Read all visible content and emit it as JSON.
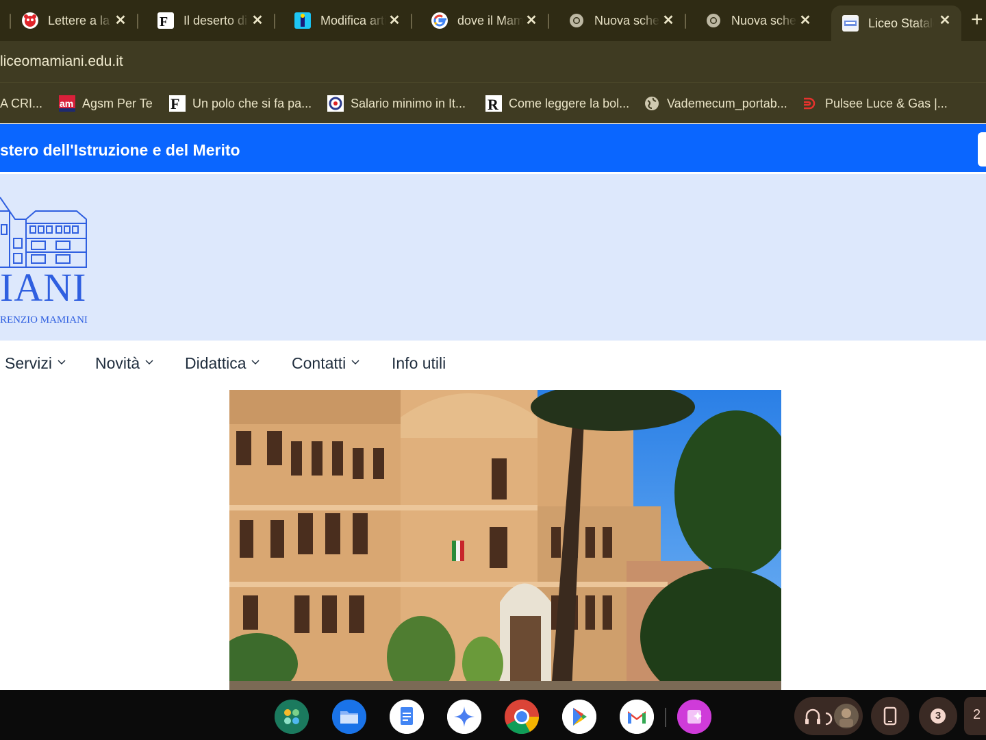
{
  "browser": {
    "tabs": [
      {
        "title": "Lettere a la redazione",
        "active": false,
        "icon": "red-mascot-icon"
      },
      {
        "title": "Il deserto di",
        "active": false,
        "icon": "f-logo-icon"
      },
      {
        "title": "Modifica articolo",
        "active": false,
        "icon": "blue-figure-icon"
      },
      {
        "title": "dove il Mamiani",
        "active": false,
        "icon": "google-icon"
      },
      {
        "title": "Nuova scheda",
        "active": false,
        "icon": "chrome-icon"
      },
      {
        "title": "Nuova scheda",
        "active": false,
        "icon": "chrome-icon"
      },
      {
        "title": "Liceo Statale",
        "active": true,
        "icon": "site-favicon-icon"
      }
    ],
    "new_tab_label": "+",
    "close_glyph": "✕",
    "url": "liceomamiani.edu.it",
    "bookmarks": [
      {
        "label": "A CRI...",
        "icon": "none"
      },
      {
        "label": "Agsm Per Te",
        "icon": "am-icon"
      },
      {
        "label": "Un polo che si fa pa...",
        "icon": "f-logo-icon"
      },
      {
        "label": "Salario minimo in It...",
        "icon": "q-logo-icon"
      },
      {
        "label": "Come leggere la bol...",
        "icon": "r-logo-icon"
      },
      {
        "label": "Vademecum_portab...",
        "icon": "globe-icon"
      },
      {
        "label": "Pulsee Luce & Gas |...",
        "icon": "pulsee-icon"
      }
    ]
  },
  "site": {
    "ministry_text": "stero dell'Istruzione e del Merito",
    "logo_name": "IANI",
    "logo_subtitle": "RENZIO MAMIANI",
    "nav": [
      {
        "label": "Servizi",
        "has_dropdown": true
      },
      {
        "label": "Novità",
        "has_dropdown": true
      },
      {
        "label": "Didattica",
        "has_dropdown": true
      },
      {
        "label": "Contatti",
        "has_dropdown": true
      },
      {
        "label": "Info utili",
        "has_dropdown": false
      }
    ],
    "hero_alt": "school-building-photo"
  },
  "shelf": {
    "apps": [
      "launcher-icon",
      "files-icon",
      "docs-icon",
      "gemini-icon",
      "chrome-icon",
      "play-store-icon",
      "gmail-icon",
      "canvas-icon"
    ],
    "notification_count": "3",
    "clock_fragment": "2"
  },
  "colors": {
    "tabstrip_bg": "#2f2b14",
    "toolbar_bg": "#3f3b22",
    "ministry_bar": "#0a66ff",
    "header_band": "#dde8fc",
    "logo_blue": "#2f5fe0"
  }
}
